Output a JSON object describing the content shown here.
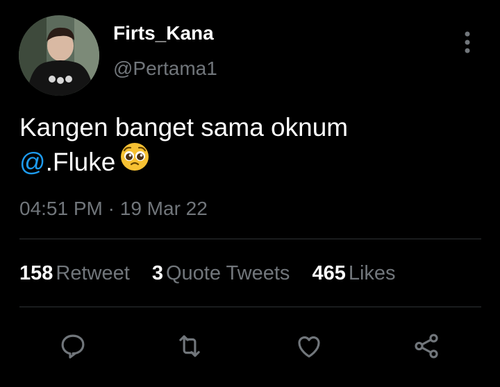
{
  "tweet": {
    "author": {
      "display_name": "Firts_Kana",
      "handle": "@Pertama1"
    },
    "text_line1": "Kangen banget sama oknum",
    "mention": "@",
    "text_line2": ".Fluke",
    "emoji": "pleading-face",
    "time": "04:51 PM",
    "separator": "·",
    "date": "19 Mar 22",
    "stats": {
      "retweets": {
        "count": "158",
        "label": "Retweet"
      },
      "quotes": {
        "count": "3",
        "label": "Quote Tweets"
      },
      "likes": {
        "count": "465",
        "label": "Likes"
      }
    },
    "actions": [
      {
        "icon": "reply-icon"
      },
      {
        "icon": "retweet-icon"
      },
      {
        "icon": "like-icon"
      },
      {
        "icon": "share-icon"
      }
    ]
  },
  "colors": {
    "background": "#000000",
    "primary_text": "#ffffff",
    "secondary_text": "#71767b",
    "accent": "#1d9bf0",
    "divider": "#2f3336"
  }
}
